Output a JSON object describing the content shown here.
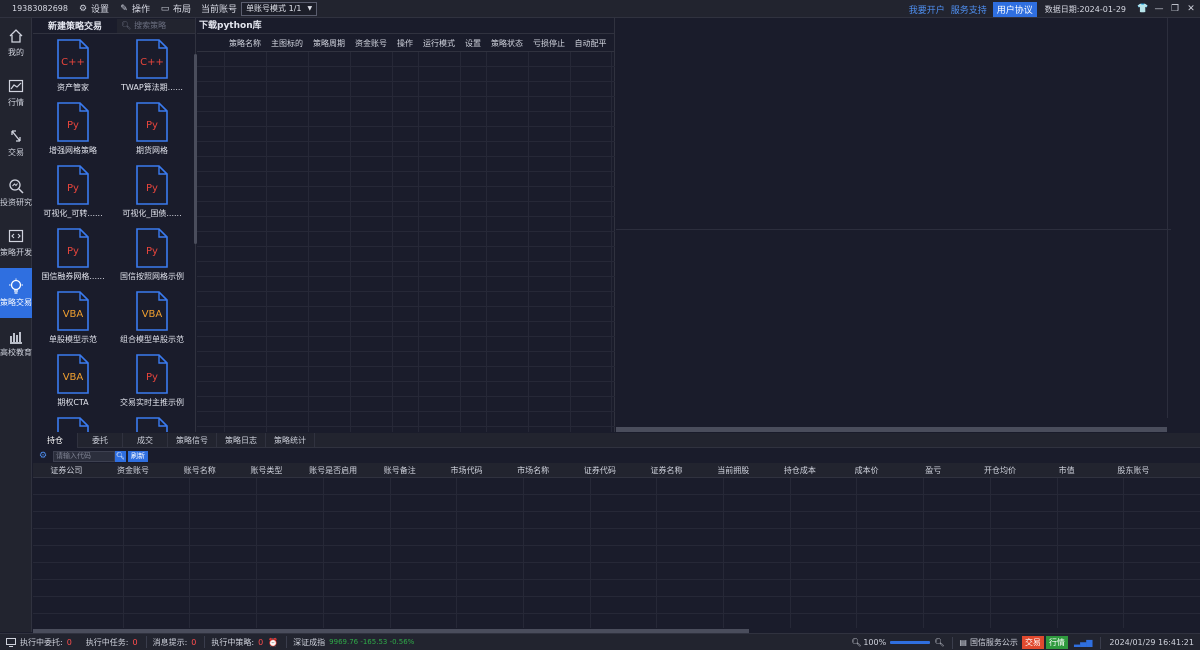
{
  "topbar": {
    "account_id": "19383082698",
    "settings_label": "设置",
    "operate_label": "操作",
    "layout_label": "布局",
    "current_account_label": "当前账号",
    "account_mode": "单账号模式 1/1",
    "open_account_link": "我要开户",
    "service_link": "服务支持",
    "user_protocol_button": "用户协议",
    "data_date_label": "数据日期:",
    "data_date": "2024-01-29"
  },
  "leftnav": {
    "items": [
      {
        "label": "我的",
        "icon": "home-icon"
      },
      {
        "label": "行情",
        "icon": "chart-icon"
      },
      {
        "label": "交易",
        "icon": "trade-icon"
      },
      {
        "label": "投资研究",
        "icon": "research-icon"
      },
      {
        "label": "策略开发",
        "icon": "code-icon"
      },
      {
        "label": "策略交易",
        "icon": "bulb-icon",
        "active": true
      },
      {
        "label": "高校教育",
        "icon": "education-icon"
      }
    ]
  },
  "strategy_panel": {
    "new_label": "新建策略交易",
    "search_placeholder": "搜索策略",
    "items": [
      {
        "type": "C++",
        "name": "资产管家"
      },
      {
        "type": "C++",
        "name": "TWAP算法期......"
      },
      {
        "type": "Py",
        "name": "增强网格策略"
      },
      {
        "type": "Py",
        "name": "期货网格"
      },
      {
        "type": "Py",
        "name": "可视化_可转......"
      },
      {
        "type": "Py",
        "name": "可视化_国债......"
      },
      {
        "type": "Py",
        "name": "国信融券网格......"
      },
      {
        "type": "Py",
        "name": "国信按照网格示例"
      },
      {
        "type": "VBA",
        "name": "单股模型示范"
      },
      {
        "type": "VBA",
        "name": "组合模型单股示范"
      },
      {
        "type": "VBA",
        "name": "期权CTA"
      },
      {
        "type": "Py",
        "name": "交易实时主推示例"
      }
    ]
  },
  "main_panel": {
    "download_python": "下载python库",
    "columns": [
      "策略名称",
      "主图标的",
      "策略周期",
      "资金账号",
      "操作",
      "运行模式",
      "设置",
      "策略状态",
      "亏损停止",
      "自动配平"
    ]
  },
  "bottom": {
    "tabs": [
      "持仓",
      "委托",
      "成交",
      "策略信号",
      "策略日志",
      "策略统计"
    ],
    "code_input_placeholder": "请输入代码",
    "refresh_label": "刷新",
    "columns": [
      "证券公司",
      "资金账号",
      "账号名称",
      "账号类型",
      "账号是否启用",
      "账号备注",
      "市场代码",
      "市场名称",
      "证券代码",
      "证券名称",
      "当前拥股",
      "持仓成本",
      "成本价",
      "盈亏",
      "开仓均价",
      "市值",
      "股东账号"
    ]
  },
  "statusbar": {
    "executing_orders_label": "执行中委托:",
    "executing_orders": "0",
    "executing_tasks_label": "执行中任务:",
    "executing_tasks": "0",
    "messages_label": "消息提示:",
    "messages": "0",
    "executing_strategies_label": "执行中策略:",
    "executing_strategies": "0",
    "index_name": "深证成指",
    "index_values": "9969.76  -165.53  -0.56%",
    "zoom": "100%",
    "notice_label": "国信服务公示",
    "trade_badge": "交易",
    "quote_badge": "行情",
    "datetime": "2024/01/29 16:41:21"
  },
  "colors": {
    "accent": "#2f6fe0",
    "background": "#1a1c2b",
    "panel": "#22242f",
    "cpp_icon": "#e8453c",
    "py_icon": "#e8453c",
    "vba_icon": "#f0a030",
    "file_border": "#3a7bf0",
    "loss_red": "#ff4d4d",
    "index_green": "#2faa48"
  }
}
